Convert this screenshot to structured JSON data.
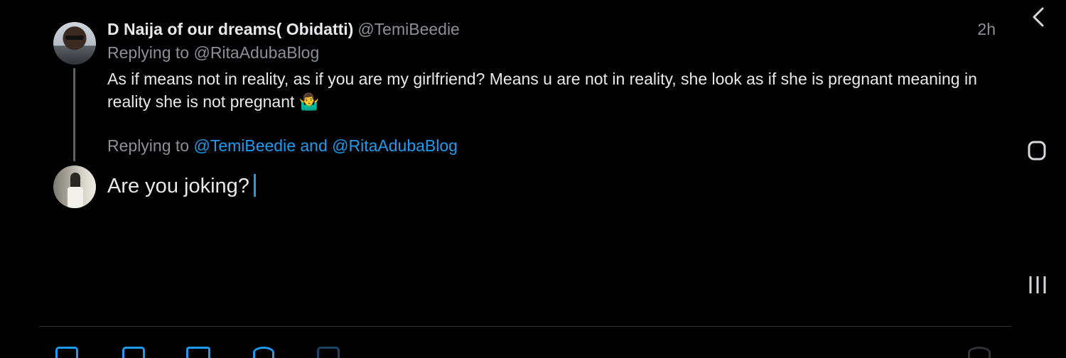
{
  "parent_tweet": {
    "display_name": "D Naija of our dreams( Obidatti)",
    "handle": "@TemiBeedie",
    "time": "2h",
    "replying_to_prefix": "Replying to",
    "replying_to_handle": "@RitaAdubaBlog",
    "body": "As if means not in reality, as if you are my girlfriend? Means u are not in reality, she look as if she is pregnant meaning in reality she is not pregnant 🤷‍♂️"
  },
  "reply_compose": {
    "replying_to_prefix": "Replying to",
    "replying_to_targets": "@TemiBeedie and @RitaAdubaBlog",
    "draft_text": "Are you joking?"
  },
  "system_nav": {
    "back_icon": "chevron-left-icon",
    "home_icon": "rounded-square-icon",
    "recents_icon": "three-bars-icon"
  },
  "colors": {
    "background": "#000000",
    "text": "#e7e9ea",
    "secondary_text": "#8b9096",
    "accent": "#1d9bf0",
    "divider": "#2f3336"
  }
}
